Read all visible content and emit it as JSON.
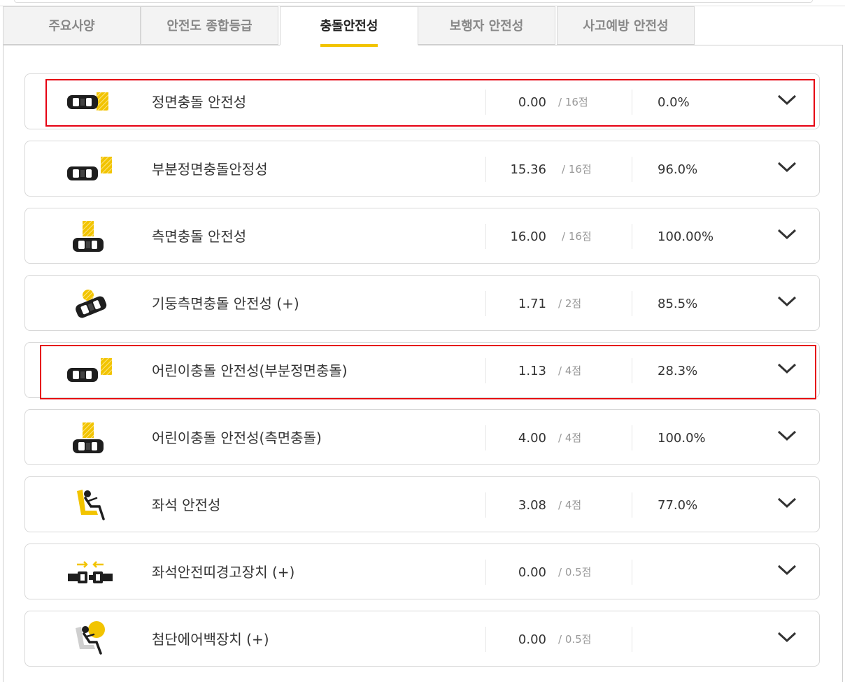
{
  "tabs": [
    {
      "label": "주요사양",
      "active": false
    },
    {
      "label": "안전도 종합등급",
      "active": false
    },
    {
      "label": "충돌안전성",
      "active": true
    },
    {
      "label": "보행자 안전성",
      "active": false
    },
    {
      "label": "사고예방 안전성",
      "active": false
    }
  ],
  "rows": [
    {
      "icon": "frontal-crash-icon",
      "title": "정면충돌 안전성",
      "score": "0.00",
      "max": "/ 16점",
      "percent": "0.0%"
    },
    {
      "icon": "partial-frontal-crash-icon",
      "title": "부분정면충돌안정성",
      "score": "15.36",
      "max": "/ 16점",
      "percent": "96.0%"
    },
    {
      "icon": "side-crash-icon",
      "title": "측면충돌 안전성",
      "score": "16.00",
      "max": "/ 16점",
      "percent": "100.00%"
    },
    {
      "icon": "pole-side-crash-icon",
      "title": "기둥측면충돌 안전성 (+)",
      "score": "1.71",
      "max": "/ 2점",
      "percent": "85.5%"
    },
    {
      "icon": "partial-frontal-crash-icon",
      "title": "어린이충돌 안전성(부분정면충돌)",
      "score": "1.13",
      "max": "/ 4점",
      "percent": "28.3%"
    },
    {
      "icon": "side-crash-icon",
      "title": "어린이충돌 안전성(측면충돌)",
      "score": "4.00",
      "max": "/ 4점",
      "percent": "100.0%"
    },
    {
      "icon": "seat-safety-icon",
      "title": "좌석 안전성",
      "score": "3.08",
      "max": "/ 4점",
      "percent": "77.0%"
    },
    {
      "icon": "seatbelt-warning-icon",
      "title": "좌석안전띠경고장치 (+)",
      "score": "0.00",
      "max": "/ 0.5점",
      "percent": ""
    },
    {
      "icon": "airbag-icon",
      "title": "첨단에어백장치 (+)",
      "score": "0.00",
      "max": "/ 0.5점",
      "percent": ""
    }
  ],
  "colors": {
    "accent": "#f2c400",
    "highlight": "#e60012"
  }
}
